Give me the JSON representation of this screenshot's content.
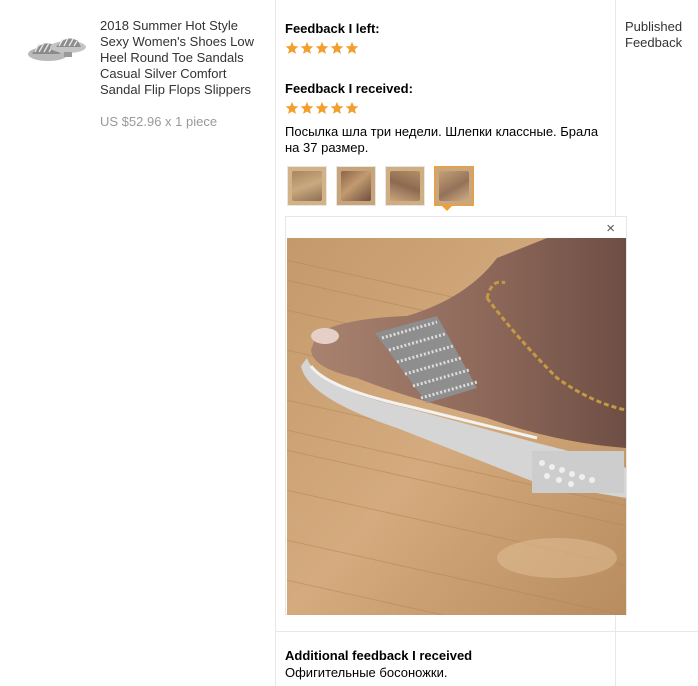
{
  "product": {
    "title": "2018 Summer Hot Style Sexy Women's Shoes Low Heel Round Toe Sandals Casual Silver Comfort Sandal Flip Flops Slippers",
    "price": "US $52.96 x 1 piece",
    "thumbnail_icon": "sandal-product-thumbnail"
  },
  "feedback_left": {
    "label": "Feedback I left:",
    "stars": 5
  },
  "feedback_received": {
    "label": "Feedback I received:",
    "stars": 5,
    "comment": "Посылка шла три недели. Шлепки классные. Брала на 37 размер.",
    "photo_count": 4,
    "selected_photo": 4
  },
  "viewer": {
    "close_glyph": "×"
  },
  "additional_feedback": {
    "label": "Additional feedback I received",
    "text": "Офигительные босоножки."
  },
  "status": {
    "label": "Published Feedback"
  },
  "colors": {
    "star": "#f29f2b",
    "border": "#e8e8e8",
    "active_thumb": "#f29f2b"
  }
}
